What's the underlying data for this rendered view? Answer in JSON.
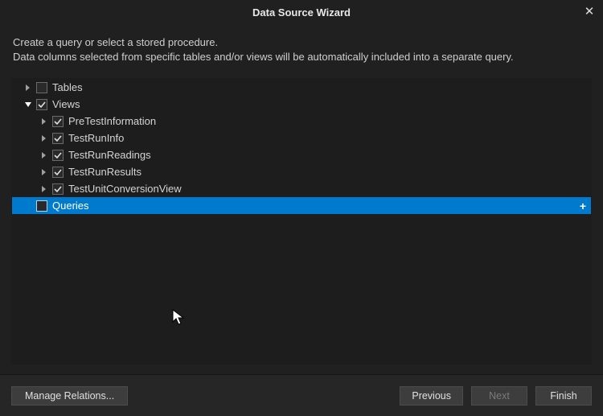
{
  "titlebar": {
    "title": "Data Source Wizard",
    "close_icon": "✕"
  },
  "description": {
    "line1": "Create a query or select a stored procedure.",
    "line2": "Data columns selected from specific tables and/or views will be automatically included into a separate query."
  },
  "tree": {
    "tables": {
      "label": "Tables",
      "expanded": false,
      "checked": false
    },
    "views": {
      "label": "Views",
      "expanded": true,
      "checked": true,
      "children": [
        {
          "label": "PreTestInformation",
          "checked": true
        },
        {
          "label": "TestRunInfo",
          "checked": true
        },
        {
          "label": "TestRunReadings",
          "checked": true
        },
        {
          "label": "TestRunResults",
          "checked": true
        },
        {
          "label": "TestUnitConversionView",
          "checked": true
        }
      ]
    },
    "queries": {
      "label": "Queries",
      "checked": false,
      "selected": true,
      "add_icon": "+"
    }
  },
  "footer": {
    "manage_relations": "Manage Relations...",
    "previous": "Previous",
    "next": "Next",
    "finish": "Finish",
    "next_enabled": false
  }
}
